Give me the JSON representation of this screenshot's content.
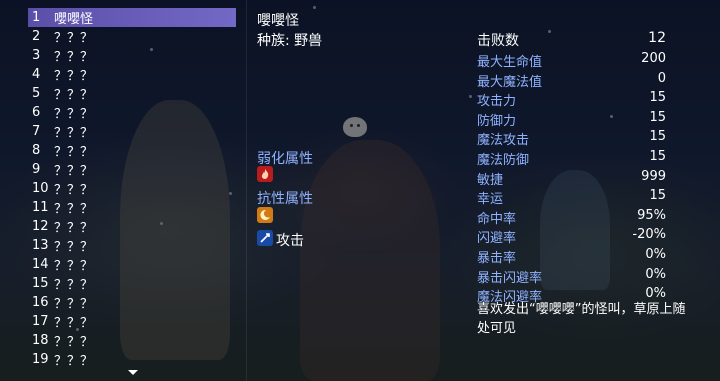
{
  "monster_list": [
    {
      "index": "1",
      "name": "嚶嚶怪",
      "selected": true
    },
    {
      "index": "2",
      "name": "？？？"
    },
    {
      "index": "3",
      "name": "？？？"
    },
    {
      "index": "4",
      "name": "？？？"
    },
    {
      "index": "5",
      "name": "？？？"
    },
    {
      "index": "6",
      "name": "？？？"
    },
    {
      "index": "7",
      "name": "？？？"
    },
    {
      "index": "8",
      "name": "？？？"
    },
    {
      "index": "9",
      "name": "？？？"
    },
    {
      "index": "10",
      "name": "？？？"
    },
    {
      "index": "11",
      "name": "？？？"
    },
    {
      "index": "12",
      "name": "？？？"
    },
    {
      "index": "13",
      "name": "？？？"
    },
    {
      "index": "14",
      "name": "？？？"
    },
    {
      "index": "15",
      "name": "？？？"
    },
    {
      "index": "16",
      "name": "？？？"
    },
    {
      "index": "17",
      "name": "？？？"
    },
    {
      "index": "18",
      "name": "？？？"
    },
    {
      "index": "19",
      "name": "？？？"
    }
  ],
  "detail": {
    "name": "嚶嚶怪",
    "race": "种族: 野兽",
    "weakness_label": "弱化属性",
    "resistance_label": "抗性属性",
    "attack_label": "攻击",
    "description": "喜欢发出“嚶嚶嚶”的怪叫，草原上随处可见"
  },
  "kill_count": {
    "label": "击败数",
    "value": "12"
  },
  "stats": [
    {
      "label": "最大生命值",
      "value": "200"
    },
    {
      "label": "最大魔法值",
      "value": "0"
    },
    {
      "label": "攻击力",
      "value": "15"
    },
    {
      "label": "防御力",
      "value": "15"
    },
    {
      "label": "魔法攻击",
      "value": "15"
    },
    {
      "label": "魔法防御",
      "value": "15"
    },
    {
      "label": "敏捷",
      "value": "999"
    },
    {
      "label": "幸运",
      "value": "15"
    },
    {
      "label": "命中率",
      "value": "95%"
    },
    {
      "label": "闪避率",
      "value": "-20%"
    },
    {
      "label": "暴击率",
      "value": "0%"
    },
    {
      "label": "暴击闪避率",
      "value": "0%"
    },
    {
      "label": "魔法闪避率",
      "value": "0%"
    }
  ],
  "icons": {
    "weakness": "fire-icon",
    "resistance": "light-crescent-icon",
    "attack": "physical-attack-icon"
  },
  "colors": {
    "selected_row": "#6a5fb8",
    "stat_label": "#8fb2ff",
    "fire_badge": "#b81c1c",
    "light_badge": "#d27a16",
    "attack_badge": "#1a4aa8"
  }
}
